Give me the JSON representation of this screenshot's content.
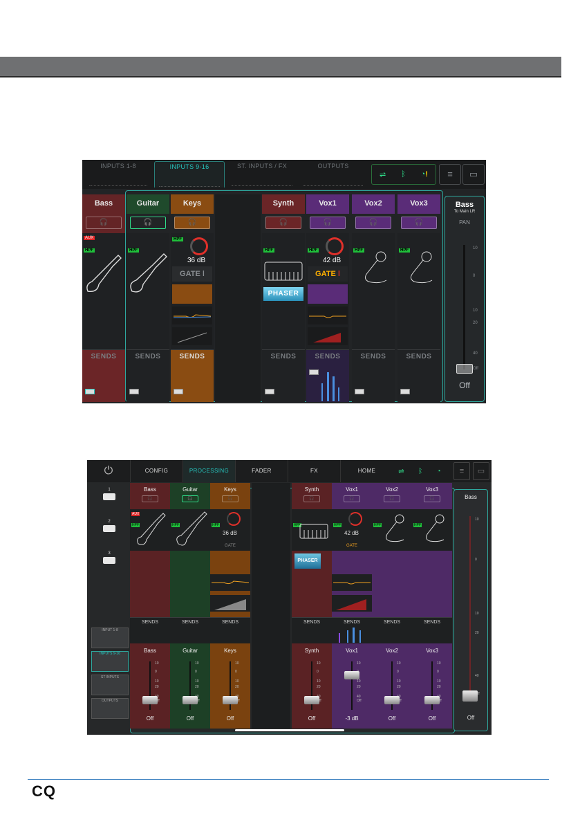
{
  "shot1": {
    "tabs": [
      "INPUTS 1-8",
      "INPUTS 9-16",
      "ST. INPUTS / FX",
      "OUTPUTS"
    ],
    "channels": [
      {
        "name": "Bass",
        "color": "#6b2527"
      },
      {
        "name": "Guitar",
        "color": "#1f4a2c"
      },
      {
        "name": "Keys",
        "color": "#8a4c12"
      },
      {
        "name": "Synth",
        "color": "#6b2527"
      },
      {
        "name": "Vox1",
        "color": "#5a2c78"
      },
      {
        "name": "Vox2",
        "color": "#5a2c78"
      },
      {
        "name": "Vox3",
        "color": "#5a2c78"
      }
    ],
    "gain_keys": "36 dB",
    "gain_vox1": "42 dB",
    "gate_label": "GATE",
    "phaser_label": "PHASER",
    "sends_label": "SENDS",
    "tag_hpf": "HPF",
    "tag_aux": "AUX",
    "master": {
      "name": "Bass",
      "sub": "To Main LR",
      "pan": "PAN",
      "value": "Off",
      "scale": [
        "10",
        "0",
        "10",
        "20",
        "40",
        "Off"
      ]
    }
  },
  "shot2": {
    "nav": [
      "CONFIG",
      "PROCESSING",
      "FADER",
      "FX",
      "HOME"
    ],
    "scenes": [
      "1",
      "2",
      "3"
    ],
    "minimaps": [
      "INPUT 1-8",
      "INPUTS 9-16",
      "ST INPUTS",
      "OUTPUTS"
    ],
    "channels": [
      {
        "name": "Bass",
        "color": "#5a2224",
        "fval": "Off"
      },
      {
        "name": "Guitar",
        "color": "#1d4026",
        "fval": "Off"
      },
      {
        "name": "Keys",
        "color": "#7a420f",
        "fval": "Off"
      },
      {
        "name": "Synth",
        "color": "#5a2224",
        "fval": "Off"
      },
      {
        "name": "Vox1",
        "color": "#4e2a66",
        "fval": "-3 dB"
      },
      {
        "name": "Vox2",
        "color": "#4e2a66",
        "fval": "Off"
      },
      {
        "name": "Vox3",
        "color": "#4e2a66",
        "fval": "Off"
      }
    ],
    "gain_keys": "36 dB",
    "gain_vox1": "42 dB",
    "gate_label": "GATE",
    "phaser_label": "PHASER",
    "sends_label": "SENDS",
    "fader_scale": [
      "10",
      "0",
      "10",
      "20",
      "40",
      "Off"
    ],
    "master": {
      "name": "Bass",
      "value": "Off",
      "scale": [
        "10",
        "0",
        "10",
        "20",
        "40",
        "Off"
      ]
    }
  },
  "footer_logo": "CQ"
}
